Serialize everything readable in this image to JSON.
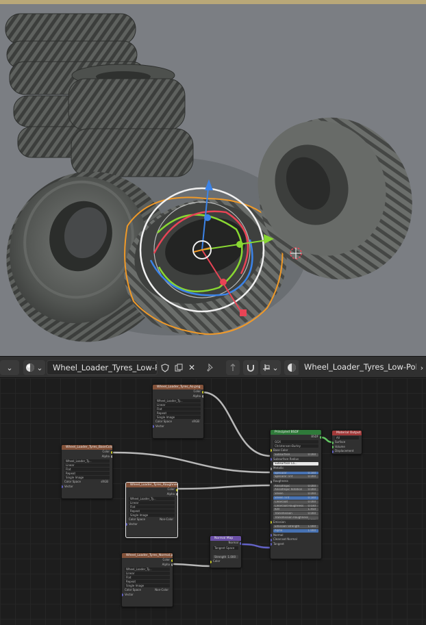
{
  "viewport": {
    "gizmo_colors": {
      "x": "#e84455",
      "y": "#89d832",
      "z": "#3b83e8",
      "select": "#f19a28"
    }
  },
  "header": {
    "material_name": "Wheel_Loader_Tyres_Low-Poly",
    "material_name_2": "Wheel_Loader_Tyres_Low-Poly",
    "close_glyph": "✕"
  },
  "nodes": {
    "tex1": {
      "title": "Wheel_Loader_Tyres_Ao.png",
      "outputs": [
        "Color",
        "Alpha"
      ],
      "image": "Wheel_Loader_Ty...",
      "interp": "Linear",
      "proj": "Flat",
      "ext": "Repeat",
      "source": "Single Image",
      "cs_label": "Color Space",
      "cs": "sRGB",
      "vec": "Vector"
    },
    "tex2": {
      "title": "Wheel_Loader_Tyres_BaseColor.png",
      "outputs": [
        "Color",
        "Alpha"
      ],
      "image": "Wheel_Loader_Ty...",
      "interp": "Linear",
      "proj": "Flat",
      "ext": "Repeat",
      "source": "Single Image",
      "cs_label": "Color Space",
      "cs": "sRGB",
      "vec": "Vector"
    },
    "tex3": {
      "title": "Wheel_Loader_Tyres_Roughness.png",
      "outputs": [
        "Color",
        "Alpha"
      ],
      "image": "Wheel_Loader_Ty...",
      "interp": "Linear",
      "proj": "Flat",
      "ext": "Repeat",
      "source": "Single Image",
      "cs_label": "Color Space",
      "cs": "Non-Color",
      "vec": "Vector"
    },
    "tex4": {
      "title": "Wheel_Loader_Tyres_Normal.png",
      "outputs": [
        "Color",
        "Alpha"
      ],
      "image": "Wheel_Loader_Ty...",
      "interp": "Linear",
      "proj": "Flat",
      "ext": "Repeat",
      "source": "Single Image",
      "cs_label": "Color Space",
      "cs": "Non-Color",
      "vec": "Vector"
    },
    "normal_map": {
      "title": "Normal Map",
      "output": "Normal",
      "space": "Tangent Space",
      "strength_label": "Strength",
      "strength": "1.000",
      "input": "Color"
    },
    "output": {
      "title": "Material Output",
      "target": "All",
      "inputs": [
        "Surface",
        "Volume",
        "Displacement"
      ]
    },
    "bsdf": {
      "title": "Principled BSDF",
      "output": "BSDF",
      "dist": "GGX",
      "sss": "Christensen-Burley",
      "rows": [
        {
          "label": "Base Color",
          "style": "plain"
        },
        {
          "label": "Subsurface",
          "value": "0.000",
          "style": "bar"
        },
        {
          "label": "Subsurface Radius",
          "style": "plain"
        },
        {
          "label": "Subsurface Co...",
          "style": "white"
        },
        {
          "label": "Metallic",
          "style": "plain"
        },
        {
          "label": "Specular",
          "value": "0.500",
          "style": "blue"
        },
        {
          "label": "Specular Tint",
          "value": "0.000",
          "style": "bar"
        },
        {
          "label": "Roughness",
          "style": "plain"
        },
        {
          "label": "Anisotropic",
          "value": "0.000",
          "style": "bar"
        },
        {
          "label": "Anisotropic Rotation",
          "value": "0.000",
          "style": "bar"
        },
        {
          "label": "Sheen",
          "value": "0.000",
          "style": "bar"
        },
        {
          "label": "Sheen Tint",
          "value": "0.500",
          "style": "blue"
        },
        {
          "label": "Clearcoat",
          "value": "0.000",
          "style": "bar"
        },
        {
          "label": "Clearcoat Roughness",
          "value": "0.030",
          "style": "bar"
        },
        {
          "label": "IOR",
          "value": "1.450",
          "style": "bar"
        },
        {
          "label": "Transmission",
          "value": "0.000",
          "style": "bar"
        },
        {
          "label": "Transmission Roughness",
          "value": "0.000",
          "style": "bar"
        },
        {
          "label": "Emission",
          "style": "plain"
        },
        {
          "label": "Emission Strength",
          "value": "1.000",
          "style": "bar"
        },
        {
          "label": "Alpha",
          "value": "1.000",
          "style": "blue"
        },
        {
          "label": "Normal",
          "style": "plain"
        },
        {
          "label": "Clearcoat Normal",
          "style": "plain"
        },
        {
          "label": "Tangent",
          "style": "plain"
        }
      ]
    }
  }
}
